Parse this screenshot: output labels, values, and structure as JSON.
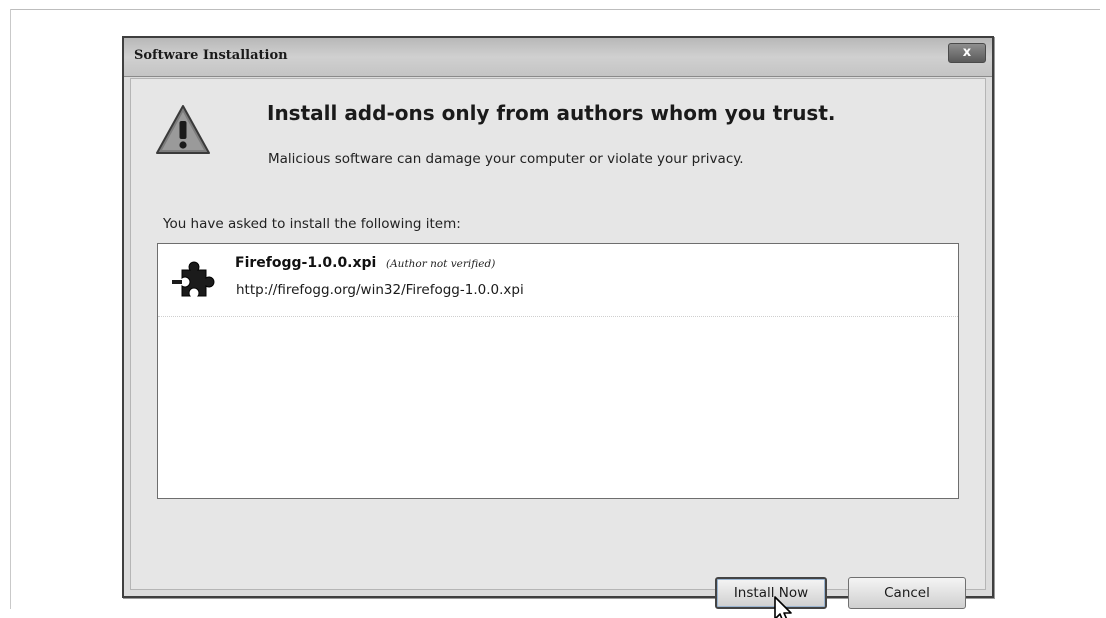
{
  "dialog": {
    "title": "Software Installation",
    "close_label": "x"
  },
  "warning": {
    "icon": "warning-icon",
    "headline": "Install add-ons only from authors whom you trust.",
    "subline": "Malicious software can damage your computer or violate your privacy."
  },
  "install_list": {
    "caption": "You have asked to install the following item:",
    "items": [
      {
        "icon": "puzzle-piece-icon",
        "name": "Firefogg-1.0.0.xpi",
        "note": "(Author not verified)",
        "url": "http://firefogg.org/win32/Firefogg-1.0.0.xpi"
      }
    ]
  },
  "buttons": {
    "install_label": "Install Now",
    "cancel_label": "Cancel"
  },
  "colors": {
    "dialog_background": "#dcdcdc",
    "list_background": "#ffffff",
    "warning_fill": "#8a8a8a"
  }
}
